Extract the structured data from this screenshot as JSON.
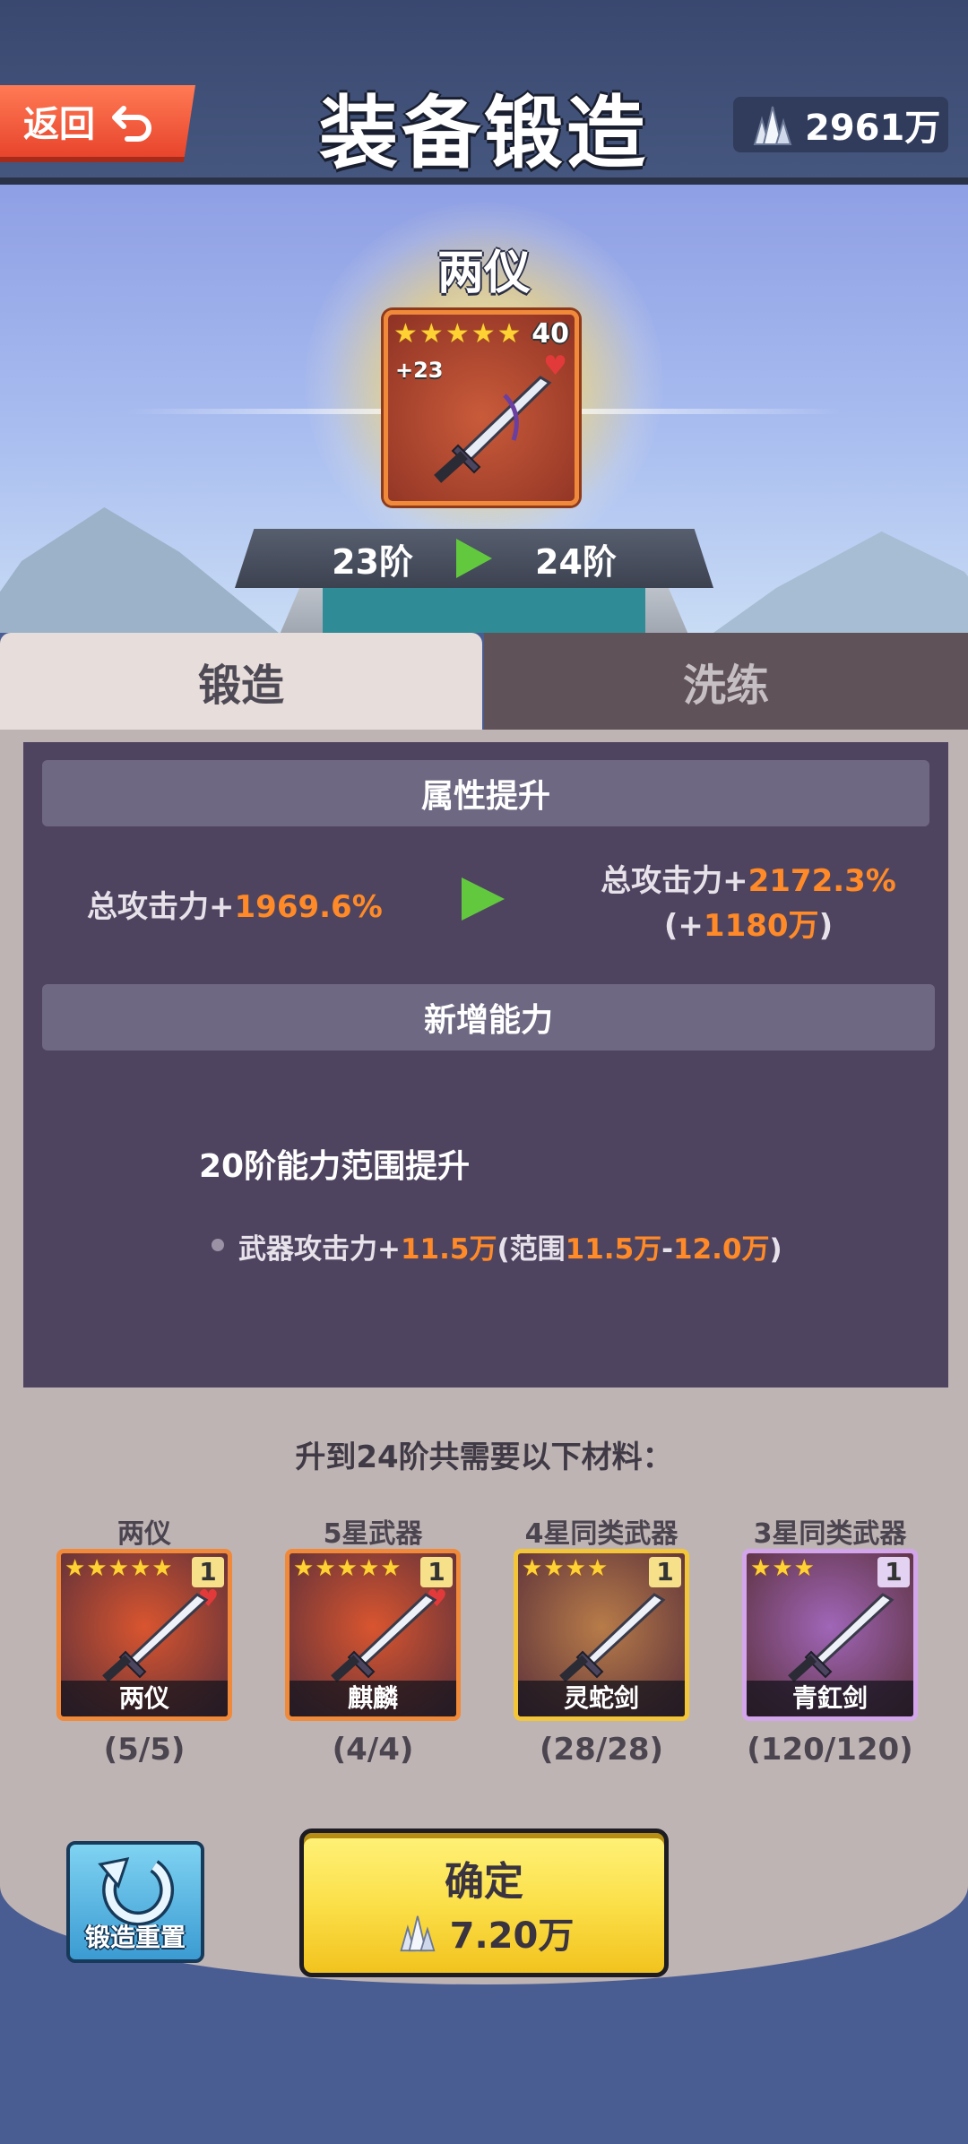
{
  "header": {
    "back_label": "返回",
    "title": "装备锻造",
    "currency_amount": "2961万"
  },
  "item": {
    "name": "两仪",
    "level": "40",
    "enhance": "+23",
    "stars": 5,
    "stage_from": "23阶",
    "stage_to": "24阶"
  },
  "tabs": {
    "forge": "锻造",
    "refine": "洗练"
  },
  "attributes": {
    "section_title": "属性提升",
    "current_prefix": "总攻击力+",
    "current_value": "1969.6%",
    "next_prefix": "总攻击力+",
    "next_value": "2172.3%",
    "next_paren_open": "(+",
    "next_bonus": "1180万",
    "next_paren_close": ")"
  },
  "abilities": {
    "section_title": "新增能力",
    "heading": "20阶能力范围提升",
    "line_prefix": "武器攻击力+",
    "line_value": "11.5万",
    "line_range_open": "(范围",
    "line_range_min": "11.5万",
    "line_range_sep": "-",
    "line_range_max": "12.0万",
    "line_range_close": ")"
  },
  "materials": {
    "title": "升到24阶共需要以下材料：",
    "items": [
      {
        "label": "两仪",
        "name": "两仪",
        "stars": 5,
        "qty": "1",
        "count": "(5/5)",
        "color": "#d9552f",
        "border": "#f08a3a"
      },
      {
        "label": "5星武器",
        "name": "麒麟",
        "stars": 5,
        "qty": "1",
        "count": "(4/4)",
        "color": "#d9552f",
        "border": "#f08a3a"
      },
      {
        "label": "4星同类武器",
        "name": "灵蛇剑",
        "stars": 4,
        "qty": "1",
        "count": "(28/28)",
        "color": "#b87c49",
        "border": "#f3c63a"
      },
      {
        "label": "3星同类武器",
        "name": "青釭剑",
        "stars": 3,
        "qty": "1",
        "count": "(120/120)",
        "color": "#a066b8",
        "border": "#d3a6ec"
      }
    ]
  },
  "actions": {
    "reset_label": "锻造重置",
    "confirm_label": "确定",
    "confirm_cost": "7.20万"
  },
  "colors": {
    "accent_orange": "#ff8a27",
    "arrow_green": "#62c93f",
    "confirm_yellow": "#fbe04a",
    "panel_purple": "#4f4460"
  }
}
